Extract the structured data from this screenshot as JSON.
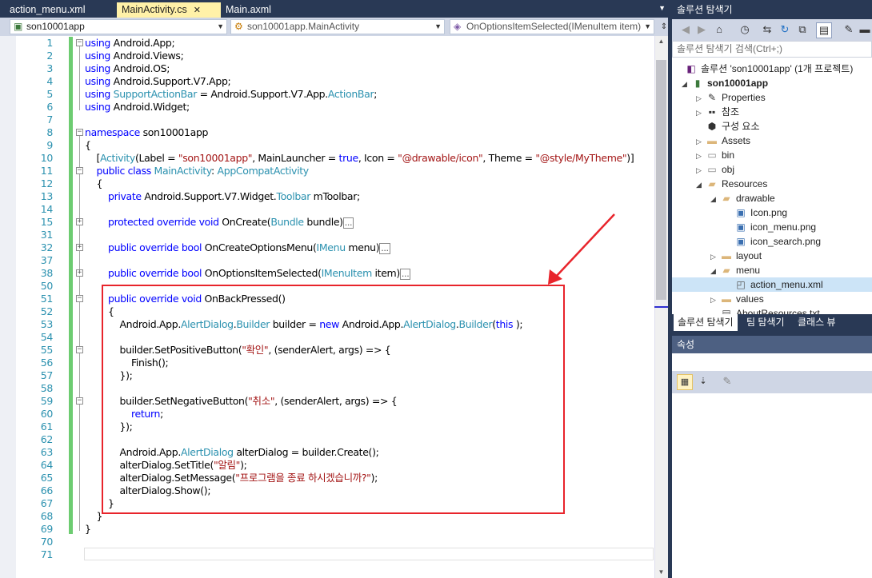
{
  "tabs": [
    {
      "label": "action_menu.xml",
      "active": false
    },
    {
      "label": "MainActivity.cs",
      "active": true,
      "close": "✕"
    },
    {
      "label": "Main.axml",
      "active": false
    }
  ],
  "navbar": {
    "project": "son10001app",
    "class": "son10001app.MainActivity",
    "member": "OnOptionsItemSelected(IMenuItem item)"
  },
  "code_lines": [
    {
      "n": "1",
      "t": [
        [
          "kw",
          "using"
        ],
        [
          "",
          "Android.App;"
        ]
      ],
      "pre": " "
    },
    {
      "n": "2",
      "t": [
        [
          "kw",
          "using"
        ],
        [
          "",
          "Android.Views;"
        ]
      ],
      "pre": " "
    },
    {
      "n": "3",
      "t": [
        [
          "kw",
          "using"
        ],
        [
          "",
          "Android.OS;"
        ]
      ],
      "pre": " "
    },
    {
      "n": "4",
      "t": [
        [
          "kw",
          "using"
        ],
        [
          "",
          "Android.Support.V7.App;"
        ]
      ],
      "pre": " "
    },
    {
      "n": "5",
      "t": [
        [
          "kw",
          "using"
        ],
        [
          "ty",
          "SupportActionBar"
        ],
        [
          "",
          " = Android.Support.V7.App."
        ],
        [
          "ty",
          "ActionBar"
        ],
        [
          "",
          ";"
        ]
      ],
      "pre": " "
    },
    {
      "n": "6",
      "t": [
        [
          "kw",
          "using"
        ],
        [
          "",
          "Android.Widget;"
        ]
      ],
      "pre": " "
    },
    {
      "n": "7",
      "t": []
    },
    {
      "n": "8",
      "t": [
        [
          "kw",
          "namespace"
        ],
        [
          "",
          "son10001app"
        ]
      ],
      "pre": " "
    },
    {
      "n": "9",
      "t": [
        [
          "",
          "{"
        ]
      ]
    },
    {
      "n": "10",
      "t": [
        [
          "",
          "    ["
        ],
        [
          "ty",
          "Activity"
        ],
        [
          "",
          "(Label = "
        ],
        [
          "st",
          "\"son10001app\""
        ],
        [
          "",
          ", MainLauncher = "
        ],
        [
          "kw",
          "true"
        ],
        [
          "",
          ", Icon = "
        ],
        [
          "st",
          "\"@drawable/icon\""
        ],
        [
          "",
          ", Theme = "
        ],
        [
          "st",
          "\"@style/MyTheme\""
        ],
        [
          "",
          ")]"
        ]
      ]
    },
    {
      "n": "11",
      "t": [
        [
          "",
          "    "
        ],
        [
          "kw",
          "public class"
        ],
        [
          "",
          ""
        ],
        [
          "ty",
          "MainActivity"
        ],
        [
          "",
          ""
        ],
        [
          "",
          ": "
        ],
        [
          "ty",
          "AppCompatActivity"
        ]
      ]
    },
    {
      "n": "12",
      "t": [
        [
          "",
          "    {"
        ]
      ]
    },
    {
      "n": "13",
      "t": [
        [
          "",
          "        "
        ],
        [
          "kw",
          "private"
        ],
        [
          "",
          " Android.Support.V7.Widget."
        ],
        [
          "ty",
          "Toolbar"
        ],
        [
          "",
          " mToolbar;"
        ]
      ]
    },
    {
      "n": "14",
      "t": []
    },
    {
      "n": "15",
      "t": [
        [
          "",
          "        "
        ],
        [
          "kw",
          "protected override void"
        ],
        [
          "",
          " OnCreate("
        ],
        [
          "ty",
          "Bundle"
        ],
        [
          "",
          " bundle)"
        ]
      ],
      "ell": true
    },
    {
      "n": "31",
      "t": []
    },
    {
      "n": "32",
      "t": [
        [
          "",
          "        "
        ],
        [
          "kw",
          "public override bool"
        ],
        [
          "",
          " OnCreateOptionsMenu("
        ],
        [
          "ty",
          "IMenu"
        ],
        [
          "",
          " menu)"
        ]
      ],
      "ell": true
    },
    {
      "n": "37",
      "t": []
    },
    {
      "n": "38",
      "t": [
        [
          "",
          "        "
        ],
        [
          "kw",
          "public override bool"
        ],
        [
          "",
          " OnOptionsItemSelected("
        ],
        [
          "ty",
          "IMenuItem"
        ],
        [
          "",
          " item)"
        ]
      ],
      "ell": true
    },
    {
      "n": "50",
      "t": []
    },
    {
      "n": "51",
      "t": [
        [
          "",
          "        "
        ],
        [
          "kw",
          "public override void"
        ],
        [
          "",
          " OnBackPressed()"
        ]
      ]
    },
    {
      "n": "52",
      "t": [
        [
          "",
          "        {"
        ]
      ]
    },
    {
      "n": "53",
      "t": [
        [
          "",
          "            Android.App."
        ],
        [
          "ty",
          "AlertDialog"
        ],
        [
          "",
          "."
        ],
        [
          "ty",
          "Builder"
        ],
        [
          "",
          " builder = "
        ],
        [
          "kw",
          "new"
        ],
        [
          "",
          " Android.App."
        ],
        [
          "ty",
          "AlertDialog"
        ],
        [
          "",
          "."
        ],
        [
          "ty",
          "Builder"
        ],
        [
          "",
          "("
        ],
        [
          "kw",
          "this"
        ],
        [
          "",
          ");"
        ]
      ]
    },
    {
      "n": "54",
      "t": []
    },
    {
      "n": "55",
      "t": [
        [
          "",
          "            builder.SetPositiveButton("
        ],
        [
          "st",
          "\"확인\""
        ],
        [
          "",
          ", (senderAlert, args) => {"
        ]
      ]
    },
    {
      "n": "56",
      "t": [
        [
          "",
          "                Finish();"
        ]
      ]
    },
    {
      "n": "57",
      "t": [
        [
          "",
          "            });"
        ]
      ]
    },
    {
      "n": "58",
      "t": []
    },
    {
      "n": "59",
      "t": [
        [
          "",
          "            builder.SetNegativeButton("
        ],
        [
          "st",
          "\"취소\""
        ],
        [
          "",
          ", (senderAlert, args) => {"
        ]
      ]
    },
    {
      "n": "60",
      "t": [
        [
          "",
          "                "
        ],
        [
          "kw",
          "return"
        ],
        [
          "",
          ";"
        ]
      ]
    },
    {
      "n": "61",
      "t": [
        [
          "",
          "            });"
        ]
      ]
    },
    {
      "n": "62",
      "t": []
    },
    {
      "n": "63",
      "t": [
        [
          "",
          "            Android.App."
        ],
        [
          "ty",
          "AlertDialog"
        ],
        [
          "",
          " alterDialog = builder.Create();"
        ]
      ]
    },
    {
      "n": "64",
      "t": [
        [
          "",
          "            alterDialog.SetTitle("
        ],
        [
          "st",
          "\"알림\""
        ],
        [
          "",
          ");"
        ]
      ]
    },
    {
      "n": "65",
      "t": [
        [
          "",
          "            alterDialog.SetMessage("
        ],
        [
          "st",
          "\"프로그램을 종료 하시겠습니까?\""
        ],
        [
          "",
          ");"
        ]
      ]
    },
    {
      "n": "66",
      "t": [
        [
          "",
          "            alterDialog.Show();"
        ]
      ]
    },
    {
      "n": "67",
      "t": [
        [
          "",
          "        }"
        ]
      ]
    },
    {
      "n": "68",
      "t": [
        [
          "",
          "    }"
        ]
      ]
    },
    {
      "n": "69",
      "t": [
        [
          "",
          "}"
        ]
      ]
    },
    {
      "n": "70",
      "t": []
    },
    {
      "n": "71",
      "t": []
    }
  ],
  "ellipsis": "...",
  "solution_explorer": {
    "title": "솔루션 탐색기",
    "search_placeholder": "솔루션 탐색기 검색(Ctrl+;)",
    "nodes": [
      {
        "label": "솔루션 'son10001app' (1개 프로젝트)",
        "icon": "solution-icon"
      },
      {
        "label": "son10001app",
        "icon": "project-icon",
        "bold": true
      },
      {
        "label": "Properties",
        "icon": "wrench-icon"
      },
      {
        "label": "참조",
        "icon": "references-icon"
      },
      {
        "label": "구성 요소",
        "icon": "components-icon"
      },
      {
        "label": "Assets",
        "icon": "folder-icon"
      },
      {
        "label": "bin",
        "icon": "folder-dotted-icon"
      },
      {
        "label": "obj",
        "icon": "folder-dotted-icon"
      },
      {
        "label": "Resources",
        "icon": "folder-open-icon"
      },
      {
        "label": "drawable",
        "icon": "folder-open-icon"
      },
      {
        "label": "Icon.png",
        "icon": "image-file-icon"
      },
      {
        "label": "icon_menu.png",
        "icon": "image-file-icon"
      },
      {
        "label": "icon_search.png",
        "icon": "image-file-icon"
      },
      {
        "label": "layout",
        "icon": "folder-icon"
      },
      {
        "label": "menu",
        "icon": "folder-open-icon"
      },
      {
        "label": "action_menu.xml",
        "icon": "xml-file-icon",
        "selected": true
      },
      {
        "label": "values",
        "icon": "folder-icon"
      },
      {
        "label": "AboutResources.txt",
        "icon": "text-file-icon"
      }
    ],
    "bottom_tabs": [
      "솔루션 탐색기",
      "팀 탐색기",
      "클래스 뷰"
    ]
  },
  "properties": {
    "title": "속성"
  },
  "colors": {
    "annotation_box": "#e8242b",
    "change_bar": "#6dcc71",
    "keyword": "#0000ff",
    "type": "#2b91af",
    "string": "#a31515"
  }
}
